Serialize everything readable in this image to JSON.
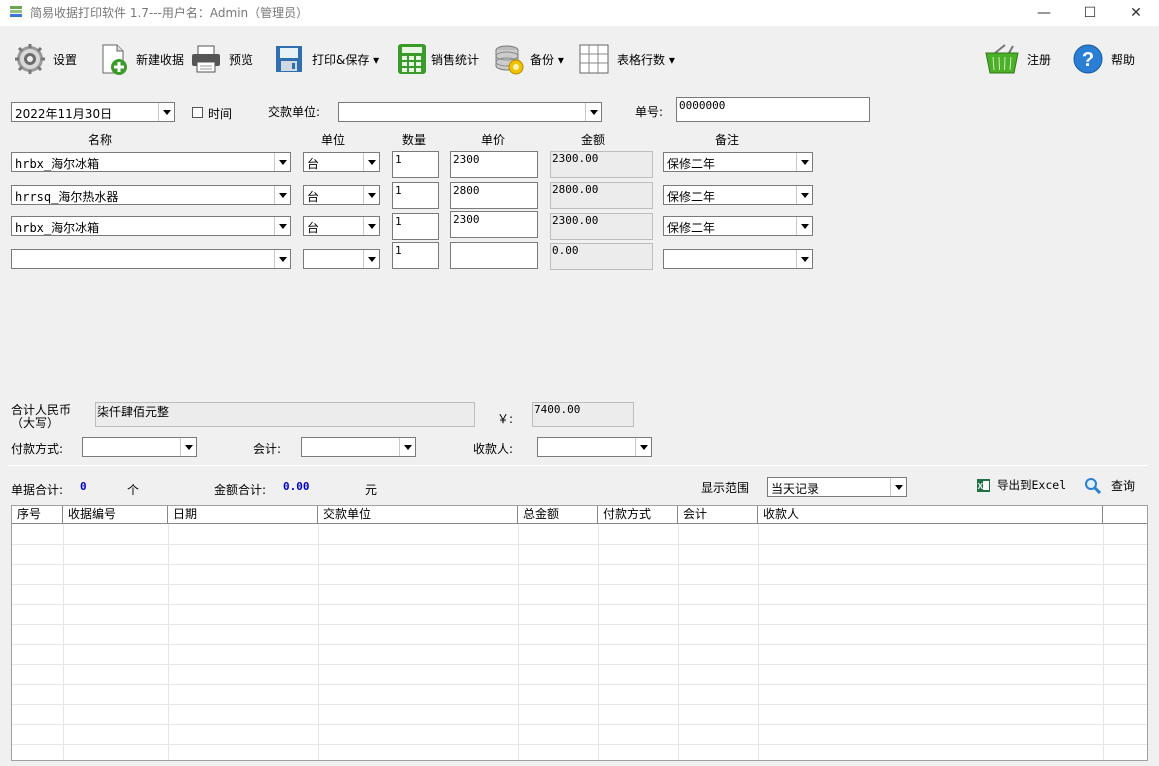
{
  "window": {
    "title": "简易收据打印软件 1.7---用户名：Admin（管理员）",
    "controls": {
      "minimize": "—",
      "maximize": "☐",
      "close": "✕"
    }
  },
  "toolbar": {
    "settings": {
      "label": "设置",
      "icon": "gear-icon"
    },
    "new_receipt": {
      "label": "新建收据",
      "icon": "new-document-icon"
    },
    "preview": {
      "label": "预览",
      "icon": "printer-icon"
    },
    "print_save": {
      "label": "打印&保存",
      "icon": "print-save-icon"
    },
    "sales_stats": {
      "label": "销售统计",
      "icon": "calculator-icon"
    },
    "backup": {
      "label": "备份",
      "icon": "database-icon"
    },
    "table_rows": {
      "label": "表格行数",
      "icon": "grid-icon"
    },
    "register": {
      "label": "注册",
      "icon": "basket-icon"
    },
    "help": {
      "label": "帮助",
      "icon": "help-icon"
    }
  },
  "form": {
    "date": "2022年11月30日",
    "time_label": "时间",
    "payer_label": "交款单位:",
    "payer_value": "",
    "number_label": "单号:",
    "number_value": "0000000",
    "headers": {
      "name": "名称",
      "unit": "单位",
      "qty": "数量",
      "price": "单价",
      "amount": "金额",
      "note": "备注"
    },
    "rows": [
      {
        "name": "hrbx_海尔冰箱",
        "unit": "台",
        "qty": "1",
        "price": "2300",
        "amount": "2300.00",
        "note": "保修二年"
      },
      {
        "name": "hrrsq_海尔热水器",
        "unit": "台",
        "qty": "1",
        "price": "2800",
        "amount": "2800.00",
        "note": "保修二年"
      },
      {
        "name": "hrbx_海尔冰箱",
        "unit": "台",
        "qty": "1",
        "price": "2300",
        "amount": "2300.00",
        "note": "保修二年"
      },
      {
        "name": "",
        "unit": "",
        "qty": "1",
        "price": "",
        "amount": "0.00",
        "note": ""
      }
    ],
    "total_cn_label_1": "合计人民币",
    "total_cn_label_2": "（大写）",
    "total_cn_value": "柒仟肆佰元整",
    "yen_label": "￥:",
    "total_value": "7400.00",
    "payment_label": "付款方式:",
    "payment_value": "",
    "accountant_label": "会计:",
    "accountant_value": "",
    "receiver_label": "收款人:",
    "receiver_value": ""
  },
  "summary": {
    "count_label": "单据合计:",
    "count_value": "0",
    "count_unit": "个",
    "amount_label": "金额合计:",
    "amount_value": "0.00",
    "amount_unit": "元",
    "range_label": "显示范围",
    "range_value": "当天记录",
    "export_label": "导出到Excel",
    "search_label": "查询"
  },
  "table": {
    "columns": [
      "序号",
      "收据编号",
      "日期",
      "交款单位",
      "总金额",
      "付款方式",
      "会计",
      "收款人"
    ]
  },
  "colors": {
    "accent_blue": "#0000c8",
    "toolbar_green": "#3a9a2a"
  }
}
